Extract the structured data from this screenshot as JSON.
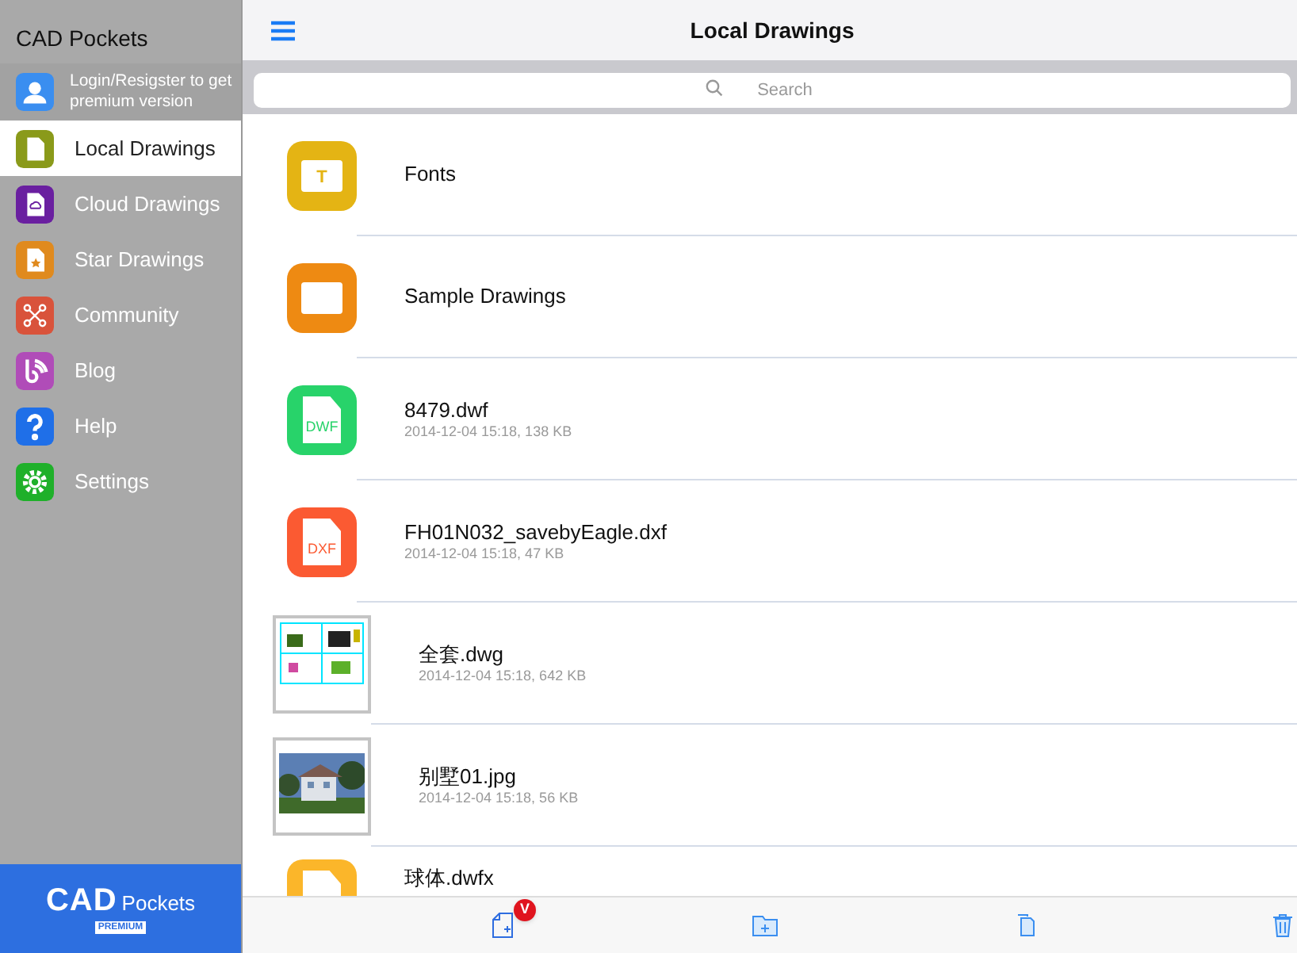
{
  "sidebar": {
    "title": "CAD Pockets",
    "login": {
      "label": "Login/Resigster to get premium version",
      "color": "#3a8ef0"
    },
    "items": [
      {
        "label": "Local Drawings",
        "color": "#8a9a1a",
        "selected": true
      },
      {
        "label": "Cloud Drawings",
        "color": "#6a1fa0",
        "selected": false
      },
      {
        "label": "Star Drawings",
        "color": "#e08a1e",
        "selected": false
      },
      {
        "label": "Community",
        "color": "#d9533b",
        "selected": false
      },
      {
        "label": "Blog",
        "color": "#b04cb8",
        "selected": false
      },
      {
        "label": "Help",
        "color": "#1f6fe8",
        "selected": false
      },
      {
        "label": "Settings",
        "color": "#1fb02a",
        "selected": false
      }
    ],
    "brand": {
      "name": "CAD",
      "suffix": "Pockets",
      "badge": "PREMIUM"
    }
  },
  "header": {
    "title": "Local Drawings"
  },
  "search": {
    "placeholder": "Search"
  },
  "files": [
    {
      "kind": "folder",
      "name": "Fonts",
      "color": "#e4b414",
      "glyph": "T"
    },
    {
      "kind": "folder",
      "name": "Sample Drawings",
      "color": "#ee8a12"
    },
    {
      "kind": "file",
      "name": "8479.dwf",
      "meta": "2014-12-04 15:18, 138 KB",
      "color": "#28d36a",
      "badge": "DWF"
    },
    {
      "kind": "file",
      "name": "FH01N032_savebyEagle.dxf",
      "meta": "2014-12-04 15:18, 47 KB",
      "color": "#fb5a32",
      "badge": "DXF"
    },
    {
      "kind": "drawing",
      "name": "全套.dwg",
      "meta": "2014-12-04 15:18, 642 KB"
    },
    {
      "name": "别墅01.jpg",
      "meta": "2014-12-04 15:18, 56 KB"
    },
    {
      "kind": "file",
      "name": "球体.dwfx",
      "color": "#fbb62a"
    }
  ],
  "toolbar": {
    "badge": "V"
  }
}
